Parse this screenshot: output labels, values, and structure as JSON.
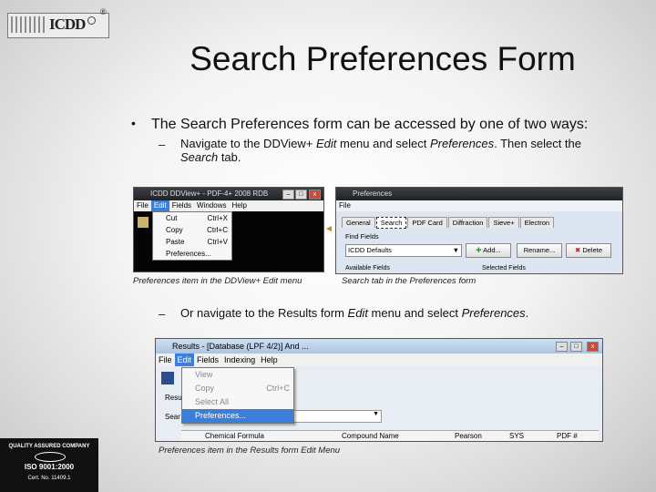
{
  "logo": {
    "text": "ICDD",
    "reg": "®"
  },
  "slide": {
    "title": "Search Preferences Form",
    "bullet": "The Search Preferences form can be accessed by one of two ways:",
    "dash": "–",
    "sub1": {
      "prefix": "Navigate to the DDView+ ",
      "edit": "Edit",
      "mid": " menu and select ",
      "prefs": "Preferences",
      "end": ". Then select the",
      "search": "Search",
      "tab": " tab."
    },
    "sub2": {
      "prefix": "Or navigate to the Results form ",
      "edit": "Edit",
      "mid": " menu and select ",
      "prefs": "Preferences",
      "end": "."
    },
    "captions": {
      "c1": "Preferences item in the DDView+ Edit menu",
      "c2": "Search tab in the Preferences form",
      "c3": "Preferences item in the Results form Edit Menu"
    }
  },
  "shot1": {
    "title": "ICDD DDView+ - PDF-4+ 2008 RDB",
    "menu": [
      "File",
      "Edit",
      "Fields",
      "Windows",
      "Help"
    ],
    "items": [
      {
        "label": "Cut",
        "shortcut": "Ctrl+X"
      },
      {
        "label": "Copy",
        "shortcut": "Ctrl+C"
      },
      {
        "label": "Paste",
        "shortcut": "Ctrl+V"
      },
      {
        "label": "Preferences..."
      }
    ]
  },
  "shot2": {
    "title": "Preferences",
    "menu": [
      "File"
    ],
    "tabs": [
      "General",
      "Search",
      "PDF Card",
      "Diffraction",
      "Sieve+",
      "Electron"
    ],
    "findfields": "Find Fields",
    "dropdown": "ICDD Defaults",
    "btn_add": "Add...",
    "btn_rename": "Rename...",
    "btn_delete": "Delete",
    "available": "Available Fields",
    "selected": "Selected Fields"
  },
  "shot3": {
    "title": "Results - [Database (LPF 4/2)] And ...",
    "menu": [
      "File",
      "Edit",
      "Fields",
      "Indexing",
      "Help"
    ],
    "items": [
      {
        "label": "View",
        "shortcut": "",
        "state": "dim"
      },
      {
        "label": "Copy",
        "shortcut": "Ctrl+C",
        "state": "dim"
      },
      {
        "label": "Select All",
        "shortcut": "",
        "state": "dim"
      },
      {
        "label": "Preferences...",
        "shortcut": "",
        "state": "sel"
      }
    ],
    "side": [
      "Resu",
      "Sear"
    ],
    "columns": [
      "Chemical Formula",
      "Compound Name",
      "Pearson",
      "SYS",
      "PDF #"
    ]
  },
  "cert": {
    "line1": "QUALITY ASSURED COMPANY",
    "line2": "ISO 9001:2000",
    "line3": "Cert. No. 11409.1"
  }
}
